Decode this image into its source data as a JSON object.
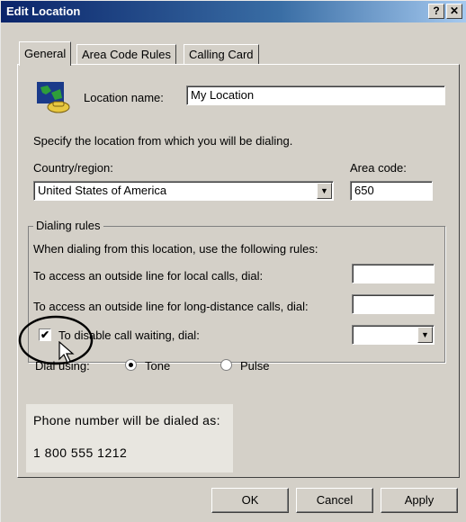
{
  "window": {
    "title": "Edit Location",
    "help_button": "?",
    "close_button": "✕"
  },
  "tabs": [
    {
      "label": "General",
      "active": true
    },
    {
      "label": "Area Code Rules",
      "active": false
    },
    {
      "label": "Calling Card",
      "active": false
    }
  ],
  "general": {
    "location_icon": "globe-phone-icon",
    "location_name_label": "Location name:",
    "location_name_value": "My Location",
    "instruction": "Specify the location from which you will be dialing.",
    "country_label": "Country/region:",
    "country_value": "United States of America",
    "area_code_label": "Area code:",
    "area_code_value": "650"
  },
  "dialing_rules": {
    "legend": "Dialing rules",
    "intro": "When dialing from this location, use the following rules:",
    "local_label": "To access an outside line for local calls, dial:",
    "local_value": "",
    "long_distance_label": "To access an outside line for long-distance calls, dial:",
    "long_distance_value": "",
    "call_waiting_label": "To disable call waiting, dial:",
    "call_waiting_checked": true,
    "call_waiting_value": "",
    "dial_using_label": "Dial using:",
    "tone_label": "Tone",
    "pulse_label": "Pulse",
    "selected_mode": "Tone"
  },
  "preview": {
    "label": "Phone number will be dialed as:",
    "number": "1 800 555 1212"
  },
  "buttons": {
    "ok": "OK",
    "cancel": "Cancel",
    "apply": "Apply"
  }
}
